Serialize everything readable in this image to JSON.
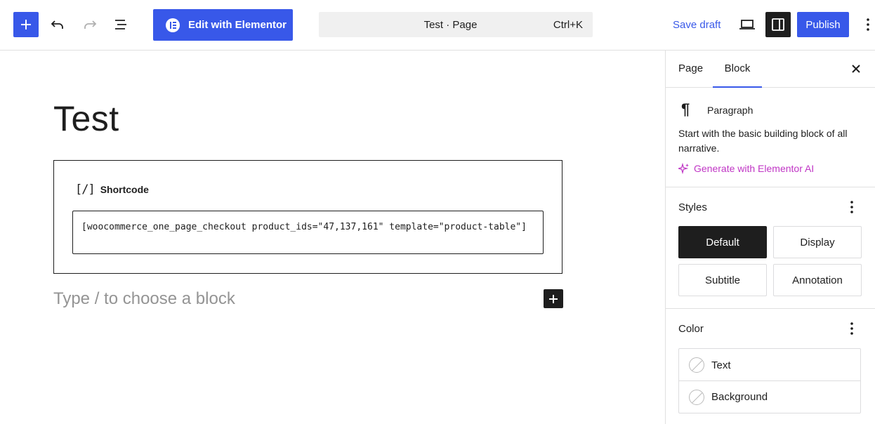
{
  "topbar": {
    "elementor_label": "Edit with Elementor",
    "doc_title": "Test · Page",
    "shortcut": "Ctrl+K",
    "save_draft": "Save draft",
    "publish": "Publish"
  },
  "editor": {
    "post_title": "Test",
    "shortcode_label": "Shortcode",
    "shortcode_icon": "[/]",
    "shortcode_value": "[woocommerce_one_page_checkout product_ids=\"47,137,161\" template=\"product-table\"]",
    "appender_placeholder": "Type / to choose a block"
  },
  "sidebar": {
    "tabs": [
      "Page",
      "Block"
    ],
    "active_tab": "Block",
    "block": {
      "icon": "¶",
      "title": "Paragraph",
      "description": "Start with the basic building block of all narrative.",
      "ai_link": "Generate with Elementor AI"
    },
    "styles": {
      "heading": "Styles",
      "options": [
        "Default",
        "Display",
        "Subtitle",
        "Annotation"
      ],
      "active": "Default"
    },
    "color": {
      "heading": "Color",
      "items": [
        "Text",
        "Background"
      ]
    }
  },
  "colors": {
    "accent": "#3858e9",
    "dark": "#1e1e1e",
    "ai": "#c036c5",
    "muted": "#949494"
  }
}
